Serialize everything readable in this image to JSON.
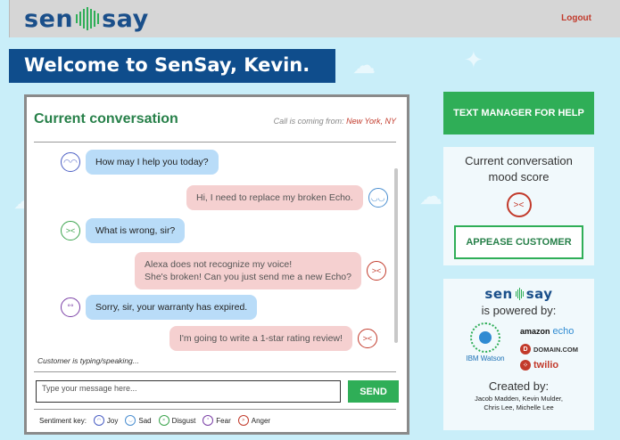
{
  "header": {
    "logo_left": "sen",
    "logo_right": "say",
    "logout_label": "Logout"
  },
  "welcome": "Welcome to SenSay, Kevin.",
  "conversation": {
    "title": "Current conversation",
    "call_from_label": "Call is coming from: ",
    "call_from_city": "New York, NY",
    "messages": [
      {
        "side": "agent",
        "emotion": "joy",
        "lines": [
          "How may I help you today?"
        ]
      },
      {
        "side": "customer",
        "emotion": "sad",
        "lines": [
          "Hi, I need to replace my broken Echo."
        ]
      },
      {
        "side": "agent",
        "emotion": "disgust",
        "lines": [
          "What is wrong, sir?"
        ]
      },
      {
        "side": "customer",
        "emotion": "anger",
        "lines": [
          "Alexa does not recognize my voice!",
          "She's broken! Can you just send me a new Echo?"
        ]
      },
      {
        "side": "agent",
        "emotion": "fear",
        "lines": [
          "Sorry, sir, your warranty has expired."
        ]
      },
      {
        "side": "customer",
        "emotion": "anger",
        "lines": [
          "I'm going to write a 1-star rating review!"
        ]
      }
    ],
    "typing_status": "Customer is typing/speaking...",
    "input_placeholder": "Type your message here...",
    "send_label": "SEND",
    "sentiment_key_label": "Sentiment key:",
    "sentiment_key": [
      {
        "emotion": "joy",
        "label": "Joy"
      },
      {
        "emotion": "sad",
        "label": "Sad"
      },
      {
        "emotion": "disgust",
        "label": "Disgust"
      },
      {
        "emotion": "fear",
        "label": "Fear"
      },
      {
        "emotion": "anger",
        "label": "Anger"
      }
    ]
  },
  "actions": {
    "text_manager_label": "TEXT MANAGER FOR HELP",
    "mood_title_1": "Current conversation",
    "mood_title_2": "mood score",
    "mood_emotion": "anger",
    "appease_label": "APPEASE CUSTOMER"
  },
  "powered": {
    "logo_left": "sen",
    "logo_right": "say",
    "powered_by": "is powered by:",
    "ibm_label": "IBM Watson",
    "amazon_label": "amazon",
    "echo_label": "echo",
    "domain_label": "DOMAIN.COM",
    "twilio_label": "twilio",
    "created_by": "Created by:",
    "names_1": "Jacob Madden, Kevin Mulder,",
    "names_2": "Chris Lee, Michelle Lee"
  },
  "colors": {
    "brand_blue": "#1a4f8a",
    "accent_green": "#2fae57",
    "alert_red": "#c23a2b",
    "background": "#c9eef9"
  }
}
